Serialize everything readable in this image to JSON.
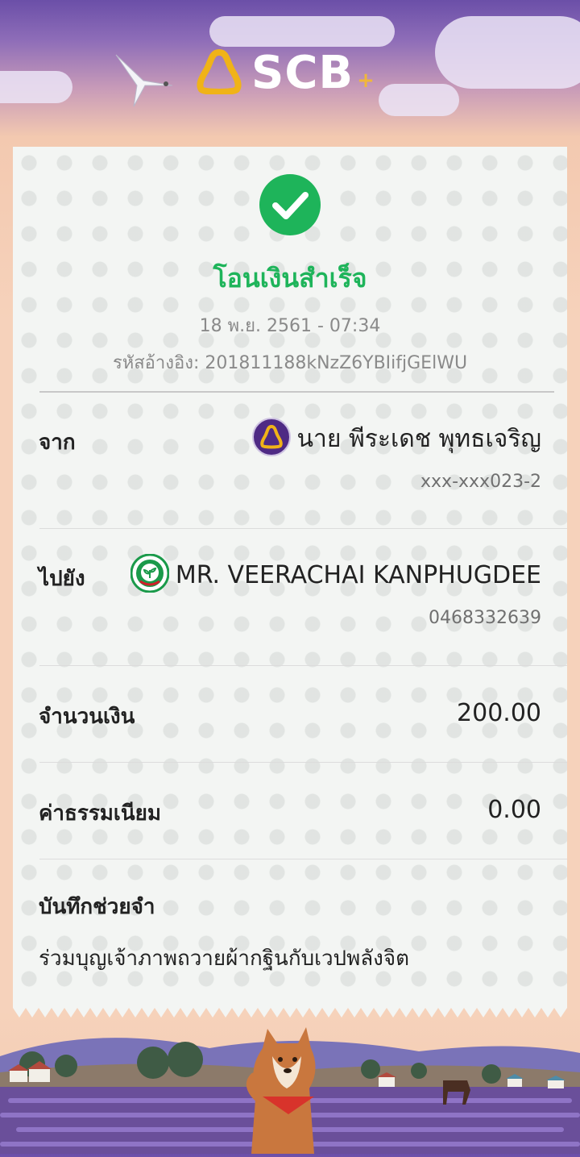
{
  "header": {
    "brand": "SCB",
    "brand_plus": "+",
    "logo_icon": "scb-symbol-icon",
    "bird_icon": "bird-icon"
  },
  "receipt": {
    "status_icon": "check-circle-icon",
    "status_color": "#1eb45a",
    "title": "โอนเงินสำเร็จ",
    "datetime": "18 พ.ย. 2561 - 07:34",
    "reference": "รหัสอ้างอิง: 201811188kNzZ6YBIifjGElWU",
    "from": {
      "label": "จาก",
      "bank_icon": "scb-bank-icon",
      "name": "นาย พีระเดช พุทธเจริญ",
      "account": "xxx-xxx023-2"
    },
    "to": {
      "label": "ไปยัง",
      "bank_icon": "kbank-bank-icon",
      "name": "MR. VEERACHAI KANPHUGDEE",
      "account": "0468332639"
    },
    "amount": {
      "label": "จำนวนเงิน",
      "value": "200.00"
    },
    "fee": {
      "label": "ค่าธรรมเนียม",
      "value": "0.00"
    },
    "note": {
      "label": "บันทึกช่วยจำ",
      "value": "ร่วมบุญเจ้าภาพถวายผ้ากฐินกับเวปพลังจิต"
    }
  },
  "footer": {
    "scene_icon": "lavender-field-shiba-illustration"
  }
}
